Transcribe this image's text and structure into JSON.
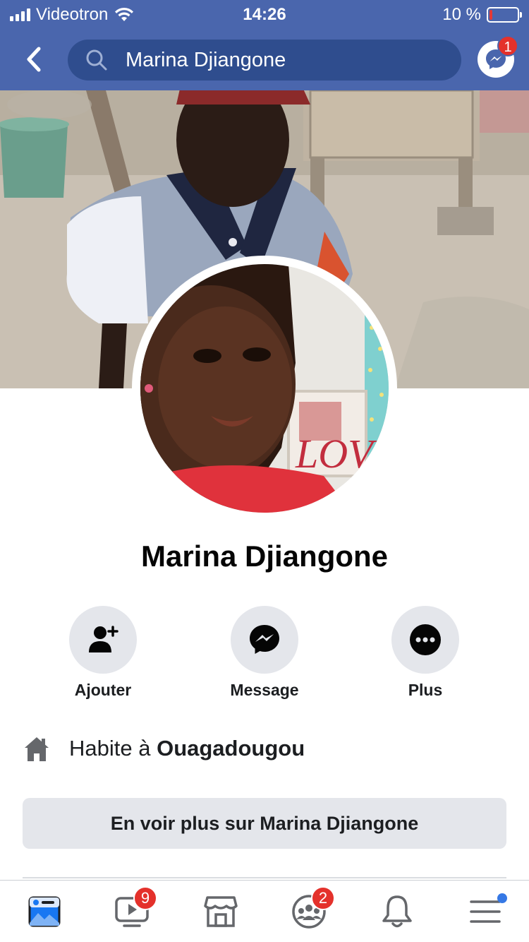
{
  "status_bar": {
    "carrier": "Videotron",
    "time": "14:26",
    "battery": "10 %",
    "battery_level": 0.1
  },
  "header": {
    "search_text": "Marina Djiangone",
    "messenger_badge": "1"
  },
  "profile": {
    "name": "Marina Djiangone",
    "avatar_overlay_text": "LOVE"
  },
  "actions": [
    {
      "label": "Ajouter",
      "icon": "add-friend-icon"
    },
    {
      "label": "Message",
      "icon": "messenger-icon"
    },
    {
      "label": "Plus",
      "icon": "more-icon"
    }
  ],
  "intro": {
    "lives_prefix": "Habite à ",
    "lives_city": "Ouagadougou",
    "icon": "home-icon"
  },
  "see_more_label": "En voir plus sur Marina Djiangone",
  "tabbar": {
    "items": [
      {
        "icon": "news-feed-icon",
        "badge": ""
      },
      {
        "icon": "watch-icon",
        "badge": "9"
      },
      {
        "icon": "marketplace-icon",
        "badge": ""
      },
      {
        "icon": "groups-icon",
        "badge": "2"
      },
      {
        "icon": "notifications-icon",
        "badge": ""
      },
      {
        "icon": "menu-icon",
        "badge": ""
      }
    ]
  },
  "colors": {
    "header": "#4a66ad",
    "searchbar": "#2f4d8e",
    "badge": "#e4312b",
    "button_bg": "#e4e6eb",
    "accent": "#3578e5"
  }
}
